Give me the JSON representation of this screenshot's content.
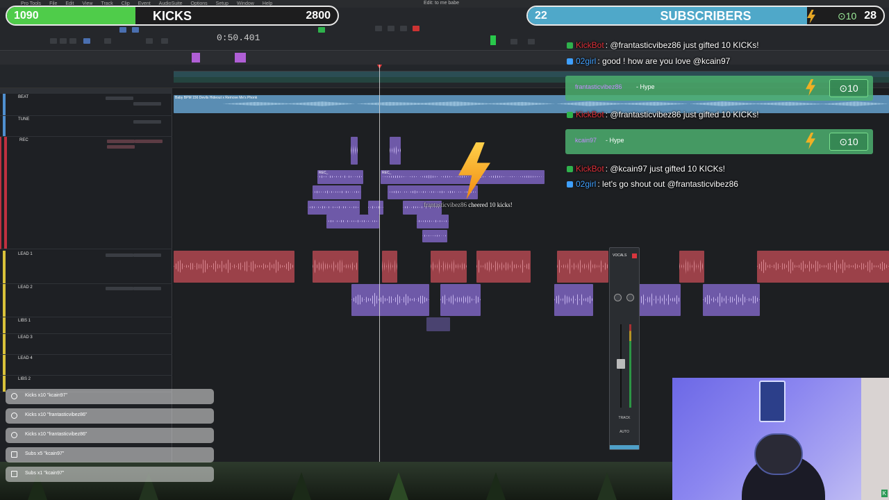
{
  "menubar": {
    "items": [
      "Pro Tools",
      "File",
      "Edit",
      "View",
      "Track",
      "Clip",
      "Event",
      "AudioSuite",
      "Options",
      "Setup",
      "Window",
      "Help"
    ],
    "session_title": "Edit: to me babe"
  },
  "transport": {
    "main_counter": "0:50.401"
  },
  "tracks": [
    {
      "name": "BEAT",
      "color": "#4f8fd0"
    },
    {
      "name": "TUNE",
      "color": "#4f8fd0"
    },
    {
      "name": "REC",
      "color": "#c03040"
    },
    {
      "name": "LEAD 1",
      "color": "#d9c23a"
    },
    {
      "name": "LEAD 2",
      "color": "#d9c23a"
    },
    {
      "name": "LIBS 1",
      "color": "#d9c23a"
    },
    {
      "name": "LEAD 3",
      "color": "#d9c23a"
    },
    {
      "name": "LEAD 4",
      "color": "#d9c23a"
    },
    {
      "name": "LIBS 2",
      "color": "#d9c23a"
    }
  ],
  "clips": {
    "beat_name": "Baby BPM 156 Devils Hideout x Remove Me's Phonk",
    "rec_label": "REC_"
  },
  "mixer_strip": {
    "name": "VOCALS",
    "track_label": "TRACK",
    "auto_label": "AUTO"
  },
  "kicks_goal": {
    "current": "1090",
    "label": "KICKS",
    "target": "2800",
    "progress": 0.389,
    "color": "#4fcc4a"
  },
  "subs_goal": {
    "current": "22",
    "label": "SUBSCRIBERS",
    "target": "28",
    "coin_value": "10",
    "progress": 0.785,
    "color": "#4fa8c9"
  },
  "chat": {
    "messages": [
      {
        "user": "KickBot",
        "user_color": "#e0303a",
        "badge_color": "#2fb24c",
        "text": ": @frantasticvibez86 just gifted 10 KICKs!"
      },
      {
        "user": "02girl",
        "user_color": "#3fa0ff",
        "badge_color": "#3fa0ff",
        "text": ": good ! how are you love @kcain97"
      },
      {
        "user": "KickBot",
        "user_color": "#e0303a",
        "badge_color": "#2fb24c",
        "text": ": @frantasticvibez86 just gifted 10 KICKs!"
      },
      {
        "user": "KickBot",
        "user_color": "#e0303a",
        "badge_color": "#2fb24c",
        "text": ": @kcain97 just gifted 10 KICKs!"
      },
      {
        "user": "02girl",
        "user_color": "#3fa0ff",
        "badge_color": "#3fa0ff",
        "text": ": let's go shout out @frantasticvibez86"
      }
    ],
    "hype_cards": [
      {
        "user": "frantasticvibez86",
        "user_color": "#c58cff",
        "label": " - Hype",
        "amount": "10"
      },
      {
        "user": "kcain97",
        "user_color": "#c58cff",
        "label": " - Hype",
        "amount": "10"
      }
    ]
  },
  "cheer_alert": {
    "user": "frantasticvibez86",
    "verb": " cheered ",
    "amount": "10",
    "suffix": " kicks!"
  },
  "events": [
    "Kicks x10 \"kcain97\"",
    "Kicks x10 \"frantasticvibez86\"",
    "Kicks x10 \"frantasticvibez86\"",
    "Subs x5 \"kcain97\"",
    "Subs x1 \"kcain97\""
  ],
  "webcam": {
    "badge": "K"
  }
}
